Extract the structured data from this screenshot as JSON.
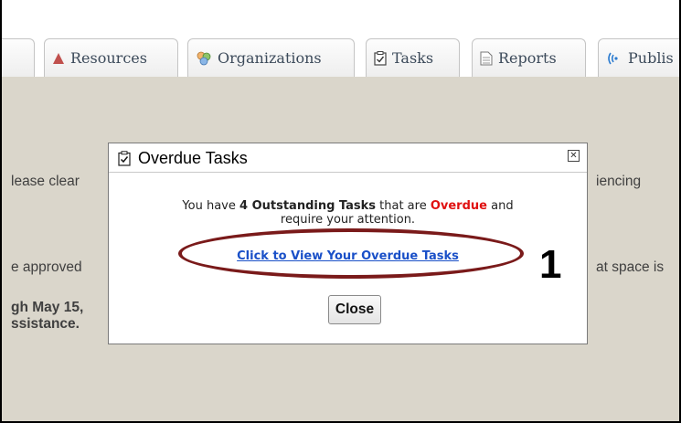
{
  "tabs": [
    {
      "label": "Resources",
      "icon": "resources-icon"
    },
    {
      "label": "Organizations",
      "icon": "organizations-icon"
    },
    {
      "label": "Tasks",
      "icon": "tasks-icon"
    },
    {
      "label": "Reports",
      "icon": "reports-icon"
    },
    {
      "label": "Publis",
      "icon": "publish-icon"
    }
  ],
  "background": {
    "line1_left": "lease clear",
    "line1_right": "iencing",
    "line2_left": "e approved",
    "line2_right": "at space is",
    "line3_left": "gh May 15,",
    "line4_left": "ssistance."
  },
  "dialog": {
    "title": "Overdue Tasks",
    "close_glyph": "✕",
    "message_prefix": "You have ",
    "message_bold": "4 Outstanding Tasks",
    "message_mid": " that are ",
    "message_red": "Overdue",
    "message_suffix": " and",
    "message_line2": "require your attention.",
    "link_text": "Click to View Your Overdue Tasks",
    "close_button": "Close"
  },
  "annotation": {
    "step_number": "1",
    "ellipse_color": "#7a1a1a"
  },
  "colors": {
    "overdue_red": "#e01010",
    "link_blue": "#1a50c8",
    "content_bg": "#dad6cb"
  }
}
